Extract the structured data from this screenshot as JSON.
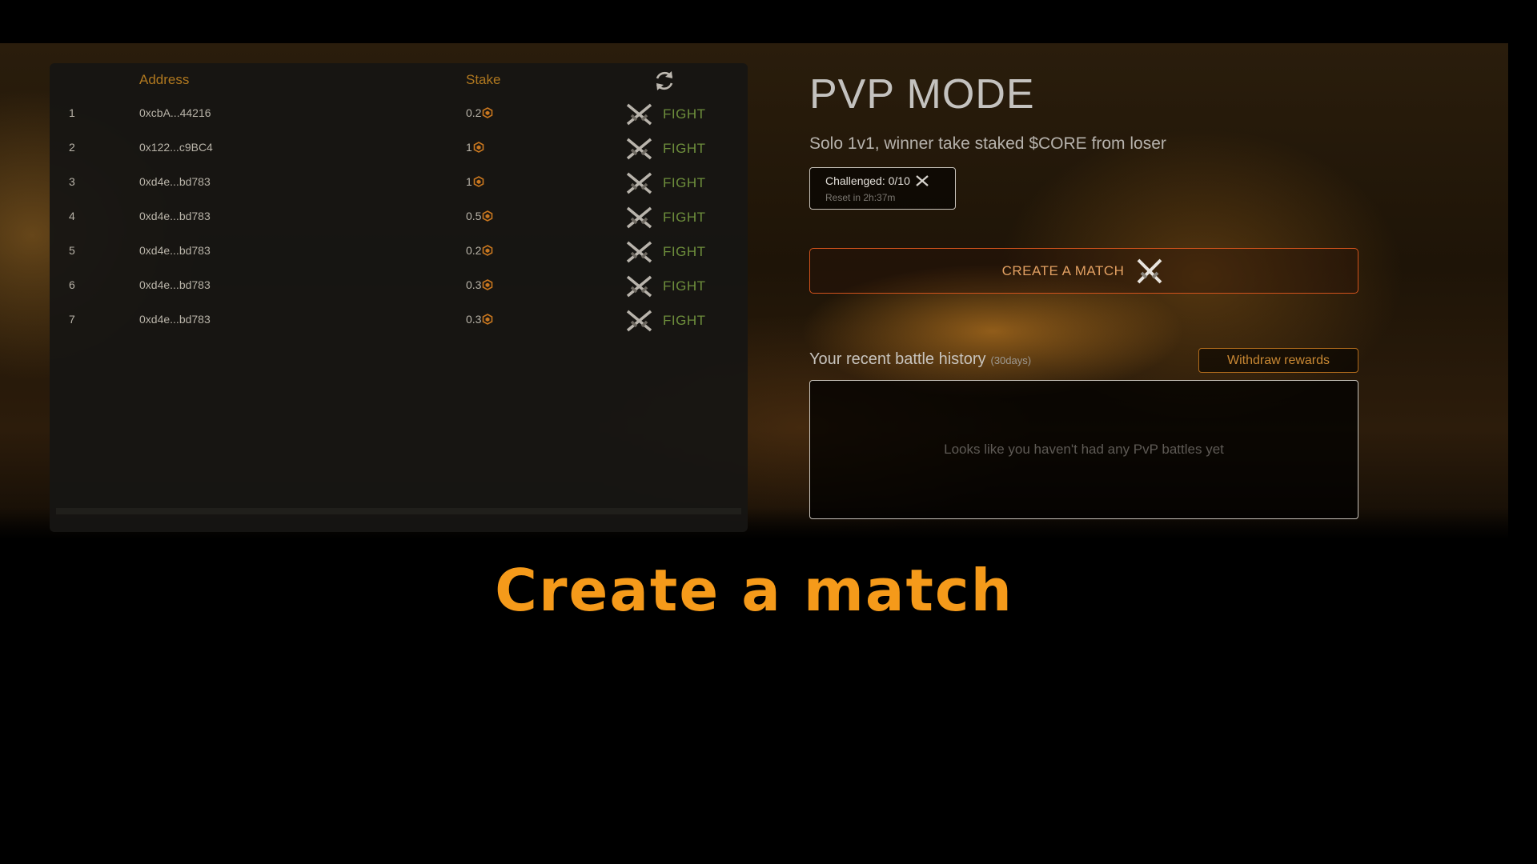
{
  "table": {
    "headers": {
      "address": "Address",
      "stake": "Stake"
    },
    "rows": [
      {
        "index": "1",
        "address": "0xcbA...44216",
        "stake": "0.2",
        "action": "FIGHT"
      },
      {
        "index": "2",
        "address": "0x122...c9BC4",
        "stake": "1",
        "action": "FIGHT"
      },
      {
        "index": "3",
        "address": "0xd4e...bd783",
        "stake": "1",
        "action": "FIGHT"
      },
      {
        "index": "4",
        "address": "0xd4e...bd783",
        "stake": "0.5",
        "action": "FIGHT"
      },
      {
        "index": "5",
        "address": "0xd4e...bd783",
        "stake": "0.2",
        "action": "FIGHT"
      },
      {
        "index": "6",
        "address": "0xd4e...bd783",
        "stake": "0.3",
        "action": "FIGHT"
      },
      {
        "index": "7",
        "address": "0xd4e...bd783",
        "stake": "0.3",
        "action": "FIGHT"
      }
    ],
    "icons": {
      "refresh": "refresh-icon",
      "coin": "core-coin-icon",
      "fight": "crossed-swords-icon"
    }
  },
  "pvp": {
    "title": "PVP MODE",
    "subtitle": "Solo 1v1, winner take staked $CORE from loser",
    "challenged": "Challenged: 0/10",
    "reset": "Reset in 2h:37m",
    "create_button": "CREATE A MATCH",
    "history_label": "Your recent battle history",
    "history_days": "(30days)",
    "withdraw_button": "Withdraw rewards",
    "empty_message": "Looks like you haven't had any PvP battles yet"
  },
  "caption": "Create a match",
  "colors": {
    "accent_orange": "#f59a1a",
    "fight_green": "#6e8f3c",
    "create_border": "#d2531c",
    "header_gold": "#b0781f"
  }
}
